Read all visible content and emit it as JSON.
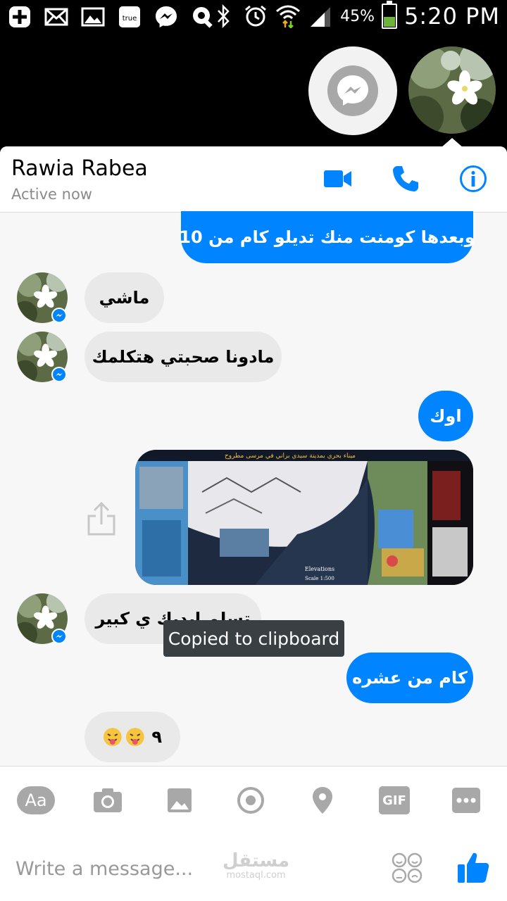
{
  "status_bar": {
    "battery_pct": "45%",
    "time": "5:20 PM",
    "battery_level": 0.45,
    "icons": [
      "plus-icon",
      "mail-icon",
      "gallery-icon",
      "true-app-icon",
      "messenger-icon",
      "key-icon",
      "bluetooth-icon",
      "alarm-icon",
      "wifi-icon",
      "signal-icon"
    ]
  },
  "header": {
    "name": "Rawia Rabea",
    "status": "Active now"
  },
  "messages": [
    {
      "dir": "out",
      "text": "وبعدها كومنت منك تديلو كام من 10"
    },
    {
      "dir": "in",
      "text": "ماشي"
    },
    {
      "dir": "in",
      "text": "مادونا صحبتي هتكلمك"
    },
    {
      "dir": "out",
      "text": "اوك"
    },
    {
      "dir": "out",
      "type": "image"
    },
    {
      "dir": "in",
      "text": "تسلم ايديك ي كبير"
    },
    {
      "dir": "out",
      "text": "كام من عشره"
    },
    {
      "dir": "in",
      "text": "٩",
      "emoji_count": 2
    }
  ],
  "image_message": {
    "title": "ميناء بحري بمدينة سيدي براني في مرسى مطروح",
    "elevations_label": "Elevations",
    "scale_label": "Scale 1:500"
  },
  "toolbar": {
    "text_button": "Aa",
    "gif_button": "GIF"
  },
  "composer": {
    "placeholder": "Write a message..."
  },
  "watermark": {
    "arabic": "مستقل",
    "latin": "mostaql.com"
  },
  "toast": "Copied to clipboard",
  "colors": {
    "accent": "#0084ff",
    "incoming_bubble": "#e9e9e9",
    "header_bg": "#ffffff",
    "chat_bg": "#f7f7f7"
  }
}
